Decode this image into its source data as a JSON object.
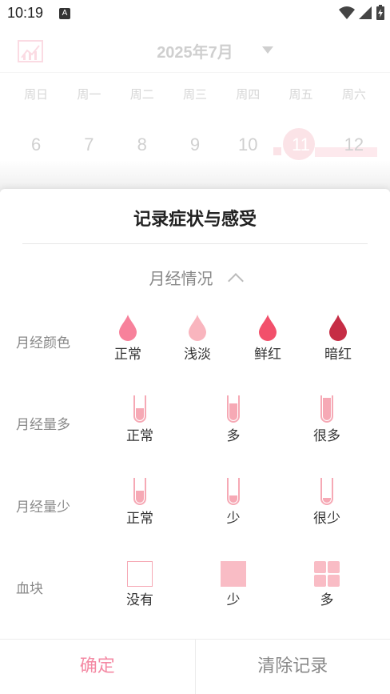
{
  "status_bar": {
    "time": "10:19",
    "notification_badge": "A",
    "icons": [
      "wifi-icon",
      "signal-icon",
      "battery-charging-icon"
    ]
  },
  "calendar": {
    "month": "2025年7月",
    "weekdays": [
      "周日",
      "周一",
      "周二",
      "周三",
      "周四",
      "周五",
      "周六"
    ],
    "days": [
      "6",
      "7",
      "8",
      "9",
      "10",
      "11",
      "12"
    ],
    "today": "11"
  },
  "sheet": {
    "title": "记录症状与感受",
    "section_title": "月经情况",
    "rows": {
      "color": {
        "label": "月经颜色",
        "options": [
          "正常",
          "浅淡",
          "鲜红",
          "暗红"
        ],
        "colors": [
          "#f7819b",
          "#f9b5be",
          "#f2506b",
          "#c62d45"
        ]
      },
      "heavy": {
        "label": "月经量多",
        "options": [
          "正常",
          "多",
          "很多"
        ],
        "fill_levels": [
          0.45,
          0.7,
          0.9
        ]
      },
      "light": {
        "label": "月经量少",
        "options": [
          "正常",
          "少",
          "很少"
        ],
        "fill_levels": [
          0.45,
          0.25,
          0.15
        ]
      },
      "clot": {
        "label": "血块",
        "options": [
          "没有",
          "少",
          "多"
        ]
      }
    },
    "footer": {
      "confirm": "确定",
      "clear": "清除记录"
    }
  },
  "accent": "#f48aa4"
}
